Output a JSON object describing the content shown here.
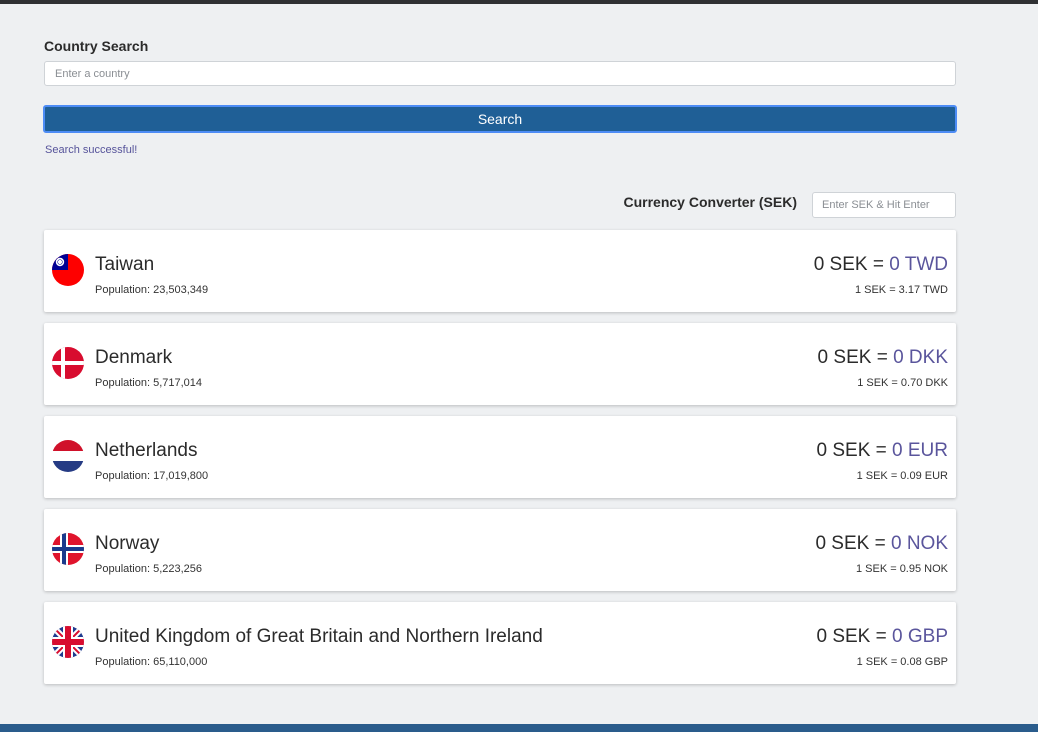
{
  "search": {
    "label": "Country Search",
    "placeholder": "Enter a country",
    "value": "",
    "button_label": "Search",
    "status": "Search successful!"
  },
  "converter": {
    "label": "Currency Converter (SEK)",
    "placeholder": "Enter SEK & Hit Enter",
    "value": ""
  },
  "countries": [
    {
      "name": "Taiwan",
      "population": "Population: 23,503,349",
      "base": "0 SEK =",
      "converted": "0 TWD",
      "rate": "1 SEK = 3.17 TWD",
      "flag_icon": "taiwan-flag-icon"
    },
    {
      "name": "Denmark",
      "population": "Population: 5,717,014",
      "base": "0 SEK =",
      "converted": "0 DKK",
      "rate": "1 SEK = 0.70 DKK",
      "flag_icon": "denmark-flag-icon"
    },
    {
      "name": "Netherlands",
      "population": "Population: 17,019,800",
      "base": "0 SEK =",
      "converted": "0 EUR",
      "rate": "1 SEK = 0.09 EUR",
      "flag_icon": "netherlands-flag-icon"
    },
    {
      "name": "Norway",
      "population": "Population: 5,223,256",
      "base": "0 SEK =",
      "converted": "0 NOK",
      "rate": "1 SEK = 0.95 NOK",
      "flag_icon": "norway-flag-icon"
    },
    {
      "name": "United Kingdom of Great Britain and Northern Ireland",
      "population": "Population: 65,110,000",
      "base": "0 SEK =",
      "converted": "0 GBP",
      "rate": "1 SEK = 0.08 GBP",
      "flag_icon": "uk-flag-icon"
    }
  ],
  "colors": {
    "primary_button": "#1f5f96",
    "accent_text": "#5a559c",
    "background": "#eef0f2",
    "footer_bar": "#2a5c8c"
  }
}
